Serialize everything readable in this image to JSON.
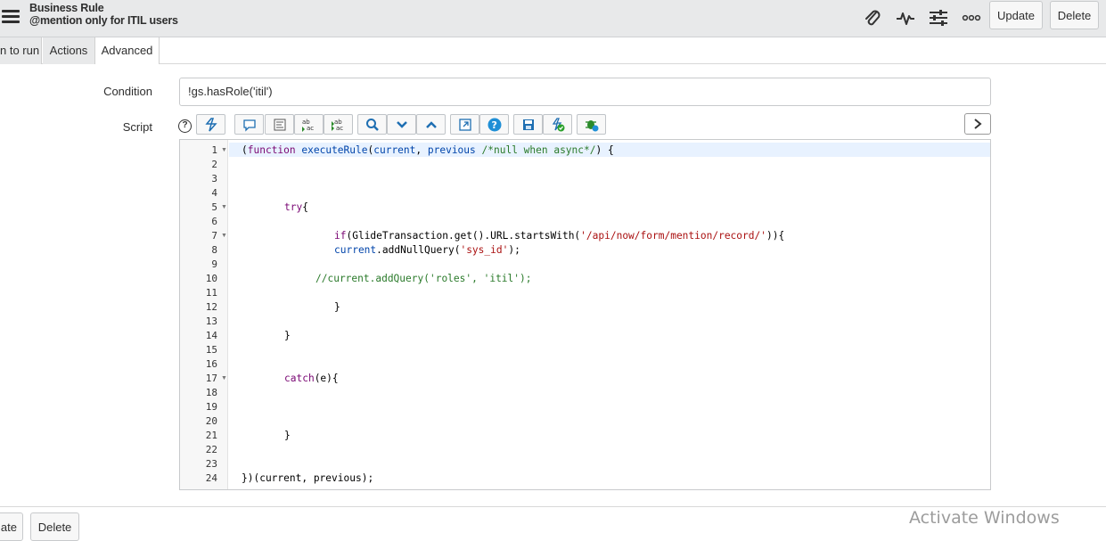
{
  "header": {
    "title": "Business Rule",
    "subtitle": "@mention only for ITIL users",
    "update_label": "Update",
    "delete_label": "Delete"
  },
  "tabs": [
    {
      "label": "n to run"
    },
    {
      "label": "Actions"
    },
    {
      "label": "Advanced",
      "active": true
    }
  ],
  "form": {
    "condition_label": "Condition",
    "condition_value": "!gs.hasRole('itil')",
    "script_label": "Script",
    "help_glyph": "?"
  },
  "editor": {
    "line_numbers": [
      "1",
      "2",
      "3",
      "4",
      "5",
      "6",
      "7",
      "8",
      "9",
      "10",
      "11",
      "12",
      "13",
      "14",
      "15",
      "16",
      "17",
      "18",
      "19",
      "20",
      "21",
      "22",
      "23",
      "24"
    ],
    "foldable_lines": [
      1,
      5,
      7,
      17
    ]
  },
  "bottom": {
    "update_partial": "ate",
    "delete_label": "Delete"
  },
  "watermark": "Activate Windows",
  "colors": {
    "header_bg": "#e8e9ea",
    "keyword": "#7a0874",
    "function": "#0044aa",
    "string": "#aa1111",
    "comment": "#2a7a2a"
  }
}
